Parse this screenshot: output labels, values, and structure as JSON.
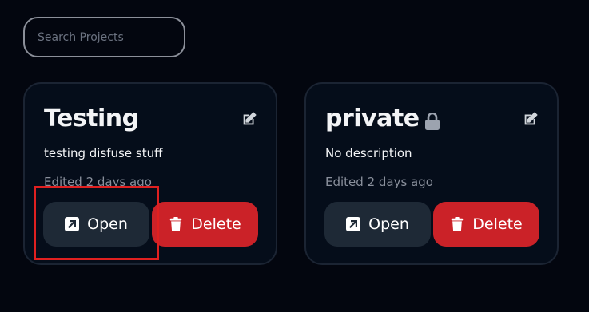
{
  "search": {
    "placeholder": "Search Projects",
    "value": ""
  },
  "projects": [
    {
      "title": "Testing",
      "locked": false,
      "description": "testing disfuse stuff",
      "edited": "Edited 2 days ago",
      "open_label": "Open",
      "delete_label": "Delete"
    },
    {
      "title": "private",
      "locked": true,
      "description": "No description",
      "edited": "Edited 2 days ago",
      "open_label": "Open",
      "delete_label": "Delete"
    }
  ],
  "icons": {
    "edit": "pencil-square-icon",
    "lock": "lock-icon",
    "open": "external-link-icon",
    "delete": "trash-icon"
  },
  "colors": {
    "background": "#03060f",
    "card_background": "#050d1a",
    "open_button": "#1e2936",
    "delete_button": "#cb2228",
    "highlight": "#e02020"
  }
}
